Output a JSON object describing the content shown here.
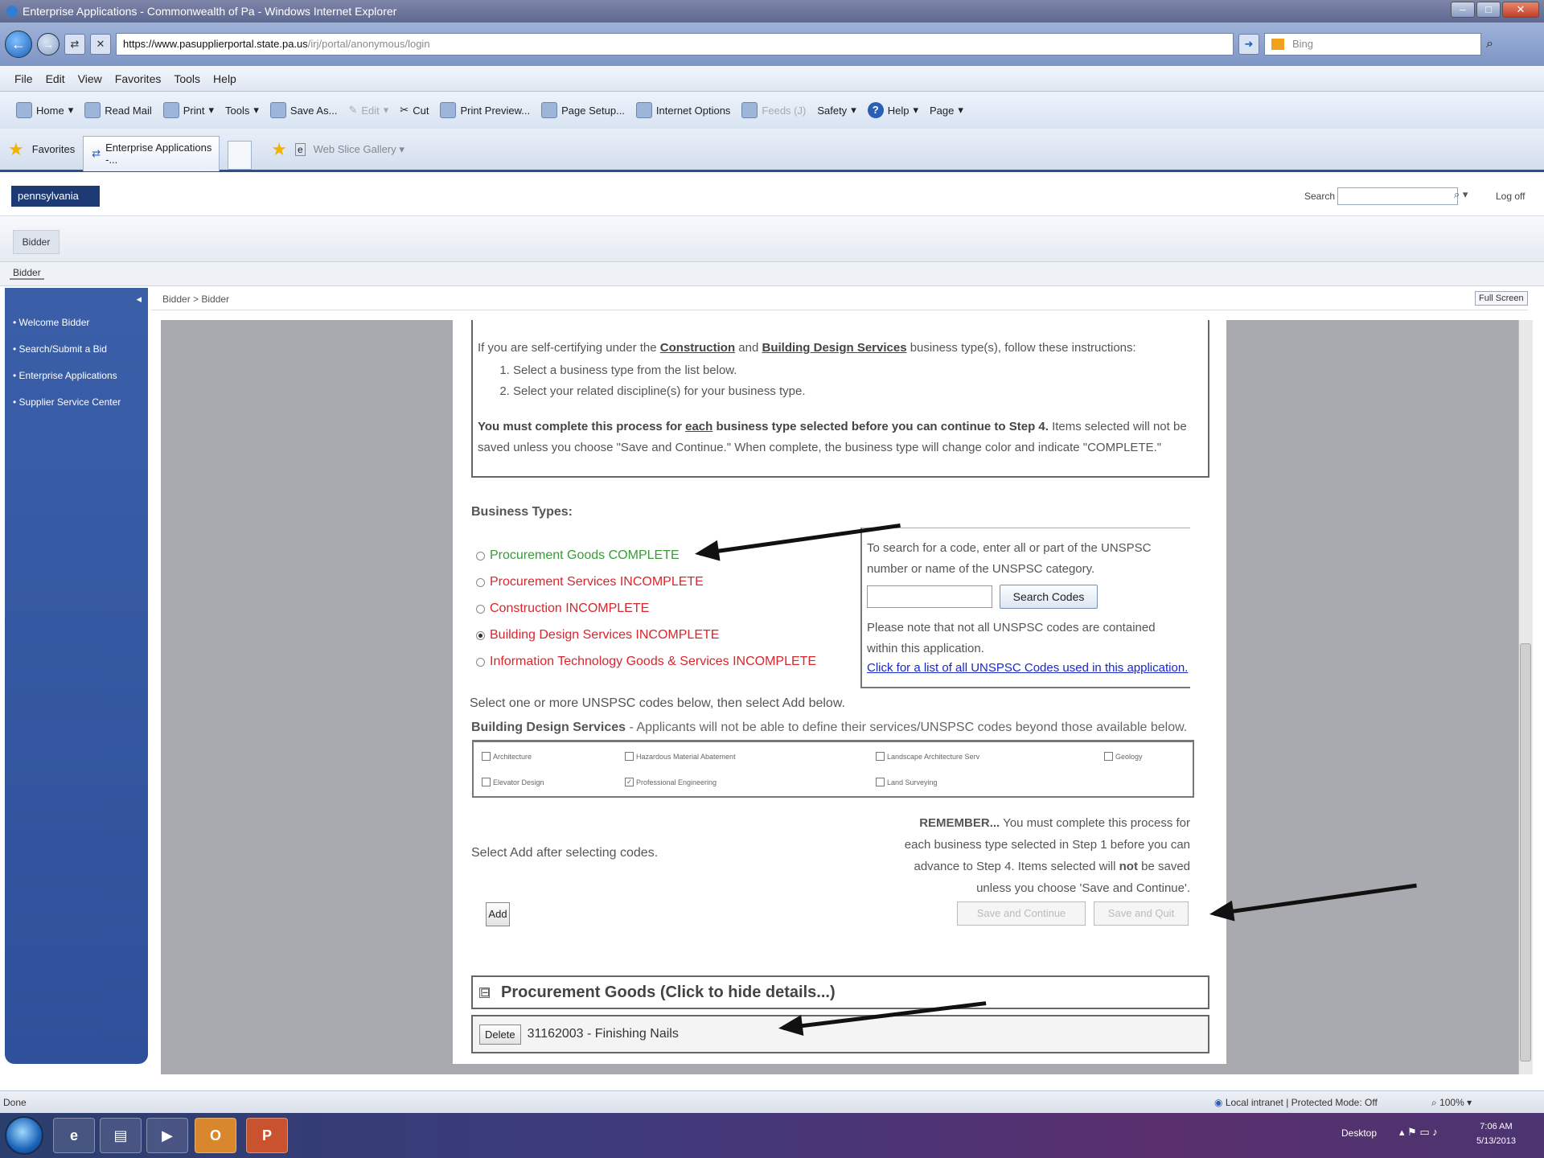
{
  "browser": {
    "window_title": "Enterprise Applications - Commonwealth of Pa - Windows Internet Explorer",
    "url_host": "https://www.pasupplierportal.state.pa.us",
    "url_path": "/irj/portal/anonymous/login",
    "search_engine": "Bing",
    "menu": [
      "File",
      "Edit",
      "View",
      "Favorites",
      "Tools",
      "Help"
    ],
    "commands": {
      "home": "Home",
      "read_mail": "Read Mail",
      "print": "Print",
      "tools": "Tools",
      "save_as": "Save As...",
      "edit": "Edit",
      "cut": "Cut",
      "print_preview": "Print Preview...",
      "page_setup": "Page Setup...",
      "internet_options": "Internet Options",
      "feeds": "Feeds (J)",
      "safety": "Safety",
      "help": "Help",
      "page": "Page"
    },
    "favorites_label": "Favorites",
    "tab_title": "Enterprise Applications -...",
    "web_slice_gallery": "Web Slice Gallery"
  },
  "portal": {
    "logo_text": "pennsylvania",
    "search_label": "Search",
    "logoff_label": "Log off",
    "nav_tab_1": "Bidder",
    "nav_tab_2": "Bidder",
    "breadcrumb": "Bidder  >  Bidder",
    "fullscreen_label": "Full Screen",
    "left_nav": [
      "Welcome Bidder",
      "Search/Submit a Bid",
      "Enterprise Applications",
      "Supplier Service Center"
    ]
  },
  "instructions": {
    "intro_pre": "If you are self-certifying under the ",
    "construction": "Construction",
    "and": " and ",
    "building_design": "Building Design Services",
    "intro_post": " business type(s), follow these instructions:",
    "step1": "Select a business type from the list below.",
    "step2": "Select your related discipline(s) for your business type.",
    "must_pre": "You must complete this process for ",
    "each": "each",
    "must_post": " business type selected before you can continue to Step 4.",
    "must_rest": " Items selected will not be saved unless you choose \"Save and Continue.\" When complete, the business type will change color and indicate \"COMPLETE.\""
  },
  "business_types": {
    "heading": "Business Types:",
    "items": [
      {
        "label": "Procurement Goods COMPLETE",
        "status": "complete",
        "selected": false
      },
      {
        "label": "Procurement Services INCOMPLETE",
        "status": "incomplete",
        "selected": false
      },
      {
        "label": "Construction INCOMPLETE",
        "status": "incomplete",
        "selected": false
      },
      {
        "label": "Building Design Services INCOMPLETE",
        "status": "incomplete",
        "selected": true
      },
      {
        "label": "Information Technology Goods & Services INCOMPLETE",
        "status": "incomplete",
        "selected": false
      }
    ]
  },
  "unspsc_search": {
    "hint": "To search for a code, enter all or part of the UNSPSC number or name of the UNSPSC category.",
    "input_value": "",
    "button": "Search Codes",
    "note": "Please note that not all UNSPSC codes are contained within this application.",
    "link": "Click for a list of all UNSPSC Codes used in this application."
  },
  "codes_section": {
    "select_one": "Select one or more UNSPSC codes below, then select Add below.",
    "bds_title": "Building Design Services",
    "bds_note": " - Applicants will not be able to define their services/UNSPSC codes beyond those available below.",
    "checkboxes": [
      {
        "label": "Architecture",
        "checked": false
      },
      {
        "label": "Hazardous Material Abatement",
        "checked": false
      },
      {
        "label": "Landscape Architecture Serv",
        "checked": false
      },
      {
        "label": "Geology",
        "checked": false
      },
      {
        "label": "Elevator Design",
        "checked": false
      },
      {
        "label": "Professional Engineering",
        "checked": true
      },
      {
        "label": "Land Surveying",
        "checked": false
      }
    ],
    "select_add": "Select Add after selecting codes.",
    "remember_bold": "REMEMBER...",
    "remember_1": " You must complete this process for each business type selected in Step 1 before you can advance to Step 4. Items selected will ",
    "remember_not": "not",
    "remember_2": " be saved unless you choose 'Save and Continue'.",
    "add_button": "Add",
    "save_continue": "Save and Continue",
    "save_quit": "Save and Quit"
  },
  "details": {
    "toggle": "⊟",
    "title": "Procurement Goods (Click to hide details...)",
    "delete_button": "Delete",
    "item": "31162003 - Finishing Nails"
  },
  "status_bar": {
    "left": "Done",
    "zone": "Local intranet | Protected Mode: Off",
    "zoom": "100%"
  },
  "taskbar": {
    "desktop": "Desktop",
    "time": "7:06 AM",
    "date": "5/13/2013"
  },
  "colors": {
    "complete": "#3a9a3a",
    "incomplete": "#d8262c",
    "link": "#1a27c8"
  }
}
